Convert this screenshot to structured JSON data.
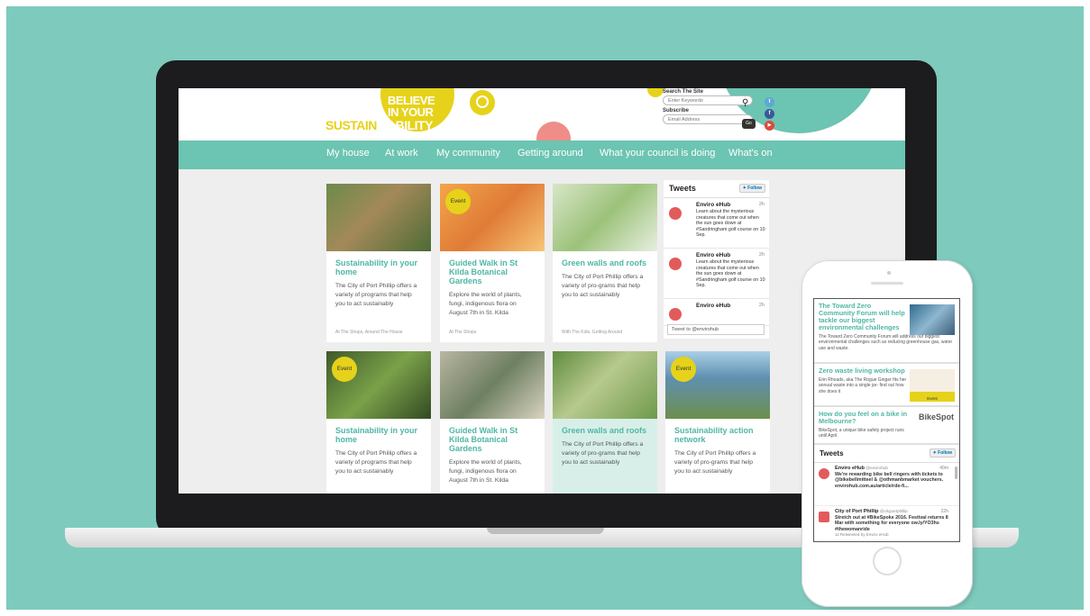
{
  "colors": {
    "background": "#7ecbbd",
    "accent": "#6cc4b2",
    "title_teal": "#4fb7a6",
    "logo_yellow": "#e6d21a",
    "tweet_red": "#e25b5b"
  },
  "site": {
    "logo": {
      "line1": "BELIEVE",
      "line2": "IN YOUR",
      "prefix": "SUSTAIN",
      "suffix": "ABILITY"
    },
    "search": {
      "label": "Search The Site",
      "placeholder": "Enter Keywords",
      "icon": "magnifier-icon"
    },
    "subscribe": {
      "label": "Subscribe",
      "placeholder": "Email Address",
      "button": "Go"
    },
    "social": {
      "twitter": "t",
      "facebook": "f",
      "youtube": "▶"
    }
  },
  "nav": [
    "My house",
    "At work",
    "My community",
    "Getting around",
    "What your council is doing",
    "What's on"
  ],
  "cards": [
    {
      "title": "Sustainability in your home",
      "text": "The City of Port Phillip offers a variety of programs that help you to act sustainably",
      "tags": "At The Shops, Around The House",
      "event": ""
    },
    {
      "title": "Guided Walk in St Kilda Botanical Gardens",
      "text": "Explore the world of plants, fungi, indigenous flora on August 7th in St. Kilda",
      "tags": "At The Shops",
      "event": "Event"
    },
    {
      "title": "Green walls and roofs",
      "text": "The City of Port Phillip offers a variety of pro-grams that help you to act sustainably",
      "tags": "With The Kids, Getting Around",
      "event": ""
    },
    {
      "title": "Sustainability in your home",
      "text": "The City of Port Phillip offers a variety of programs that help you to act sustainably",
      "tags": "",
      "event": "Event"
    },
    {
      "title": "Guided Walk in St Kilda Botanical Gardens",
      "text": "Explore the world of plants, fungi, indigenous flora on August 7th in St. Kilda",
      "tags": "",
      "event": ""
    },
    {
      "title": "Green walls and roofs",
      "text": "The City of Port Phillip offers a variety of pro-grams that help you to act sustainably",
      "tags": "",
      "event": ""
    },
    {
      "title": "Sustainability action network",
      "text": "The City of Port Phillip offers a variety of pro-grams that help you to act sustainably",
      "tags": "",
      "event": "Event"
    }
  ],
  "tweets": {
    "title": "Tweets",
    "follow": "Follow",
    "items": [
      {
        "name": "Enviro eHub",
        "time": "2h",
        "text": "Learn about the mysterious creatures that come out when the sun goes down at #Sandringham golf course on 10 Sep."
      },
      {
        "name": "Enviro eHub",
        "time": "2h",
        "text": "Learn about the mysterious creatures that come out when the sun goes down at #Sandringham golf course on 10 Sep."
      },
      {
        "name": "Enviro eHub",
        "time": "2h",
        "text": ""
      }
    ],
    "input_placeholder": "Tweet to @envirohub"
  },
  "phone": {
    "articles": [
      {
        "title": "The Toward Zero Community Forum will help tackle our biggest environmental challenges",
        "text": "The Toward Zero Community Forum will address our biggest environmental challenges such as reducing greenhouse gas, water use and waste."
      },
      {
        "title": "Zero waste living workshop",
        "text": "Erin Rhoads, aka The Rogue Ginger fits her annual waste into a single jar- find out how she does it",
        "badge": "Event"
      },
      {
        "title": "How do you feel on a bike in Melbourne?",
        "text": "BikeSpot, a unique bike safety project runs until April.",
        "logo": "BikeSpot"
      }
    ],
    "tweets_title": "Tweets",
    "follow": "Follow",
    "tweets": [
      {
        "name": "Enviro eHub",
        "handle": "@envirohub",
        "time": "40m",
        "text": "We're rewarding bike bell ringers with tickets to @bikebellmitteel & @othmanbmarket vouchers. envirohub.com.au/article/rde-fi..."
      },
      {
        "name": "City of Port Phillip",
        "handle": "@cityportphillip",
        "time": "22h",
        "text": "Stretch out at #BikeSpoke 2016. Festival returns 8 Mar with something for everyone ow.ly/YO3hs #thewomanride",
        "note": "11 Retweeted by Enviro eHub"
      }
    ]
  }
}
